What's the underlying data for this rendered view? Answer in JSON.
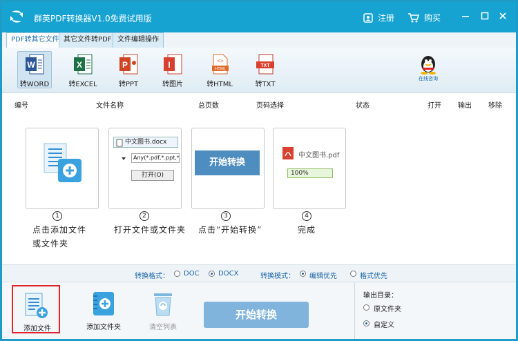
{
  "window": {
    "title": "群英PDF转换器V1.0免费试用版",
    "register": "注册",
    "buy": "购买"
  },
  "tabs": [
    {
      "label": "PDF转其它文件",
      "active": true
    },
    {
      "label": "其它文件转PDF",
      "active": false
    },
    {
      "label": "文件编辑操作",
      "active": false
    }
  ],
  "tools": [
    {
      "label": "转WORD",
      "icon": "word-icon",
      "active": true
    },
    {
      "label": "转EXCEL",
      "icon": "excel-icon"
    },
    {
      "label": "转PPT",
      "icon": "ppt-icon"
    },
    {
      "label": "转图片",
      "icon": "image-icon"
    },
    {
      "label": "转HTML",
      "icon": "html-icon"
    },
    {
      "label": "转TXT",
      "icon": "txt-icon"
    }
  ],
  "qq": {
    "label": "在线咨询"
  },
  "columns": [
    "编号",
    "文件名称",
    "总页数",
    "页码选择",
    "状态",
    "打开",
    "输出",
    "移除"
  ],
  "guide": {
    "step1": {
      "num": "1",
      "text1": "点击添加文件",
      "text2": "或文件夹"
    },
    "step2": {
      "num": "2",
      "text": "打开文件或文件夹",
      "file": "中文图书.docx",
      "filter": "Any(*.pdf,*.ppt,*",
      "open": "打开(O)"
    },
    "step3": {
      "num": "3",
      "text": "点击“开始转换”",
      "button": "开始转换"
    },
    "step4": {
      "num": "4",
      "text": "完成",
      "file": "中文图书.pdf",
      "progress": "100%"
    }
  },
  "options": {
    "format_label": "转换格式：",
    "format_doc": "DOC",
    "format_docx": "DOCX",
    "format_selected": "DOCX",
    "mode_label": "转换模式：",
    "mode_edit": "编辑优先",
    "mode_layout": "格式优先",
    "mode_selected": "编辑优先"
  },
  "bottom": {
    "add_file": "添加文件",
    "add_folder": "添加文件夹",
    "clear_list": "清空列表",
    "start": "开始转换",
    "output_label": "输出目录：",
    "out_original": "原文件夹",
    "out_custom": "自定义",
    "out_selected": "自定义"
  },
  "colors": {
    "titlebar": "#17a3d2",
    "accent": "#1b66a8",
    "start_button": "#80b4dc",
    "highlight_border": "#e0262b"
  }
}
